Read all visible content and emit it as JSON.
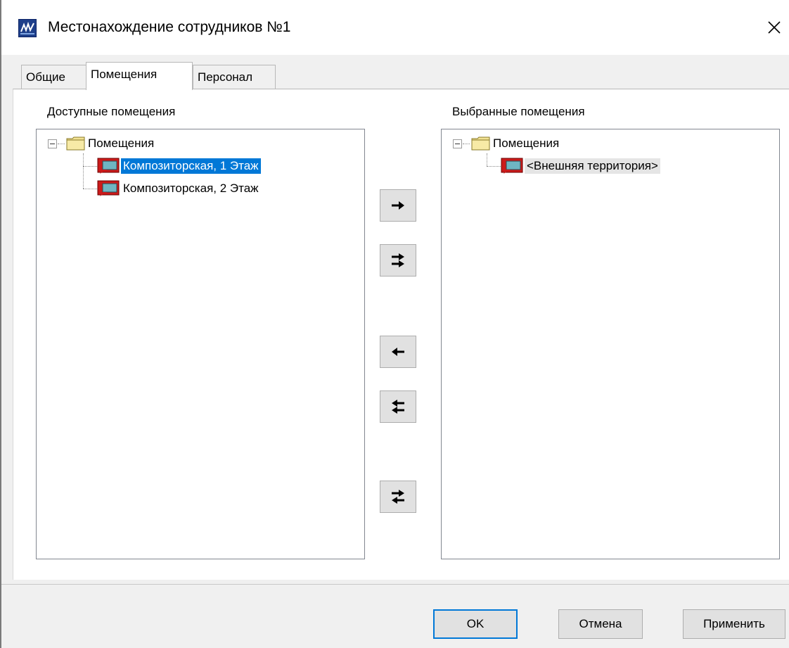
{
  "window": {
    "title": "Местонахождение сотрудников №1",
    "close_icon": "close-icon",
    "app_icon": "app-icon"
  },
  "tabs": [
    {
      "label": "Общие",
      "active": false
    },
    {
      "label": "Помещения",
      "active": true
    },
    {
      "label": "Персонал",
      "active": false
    }
  ],
  "available": {
    "label": "Доступные помещения",
    "root": "Помещения",
    "items": [
      {
        "label": "Композиторская, 1 Этаж",
        "selected": true
      },
      {
        "label": "Композиторская, 2 Этаж",
        "selected": false
      }
    ]
  },
  "selected": {
    "label": "Выбранные помещения",
    "root": "Помещения",
    "items": [
      {
        "label": "<Внешняя территория>",
        "selected": false
      }
    ]
  },
  "transfer_buttons": [
    {
      "name": "move-right-button",
      "icon": "arrow-right-icon"
    },
    {
      "name": "move-all-right-button",
      "icon": "double-arrow-right-icon"
    },
    {
      "name": "move-left-button",
      "icon": "arrow-left-icon"
    },
    {
      "name": "move-all-left-button",
      "icon": "double-arrow-left-icon"
    },
    {
      "name": "swap-button",
      "icon": "swap-arrows-icon"
    }
  ],
  "footer": {
    "ok": "OK",
    "cancel": "Отмена",
    "apply": "Применить"
  },
  "colors": {
    "selection": "#0078d7",
    "folder": "#f2e394",
    "room_icon": "#cc1a1a",
    "default_button_border": "#0078d7"
  }
}
